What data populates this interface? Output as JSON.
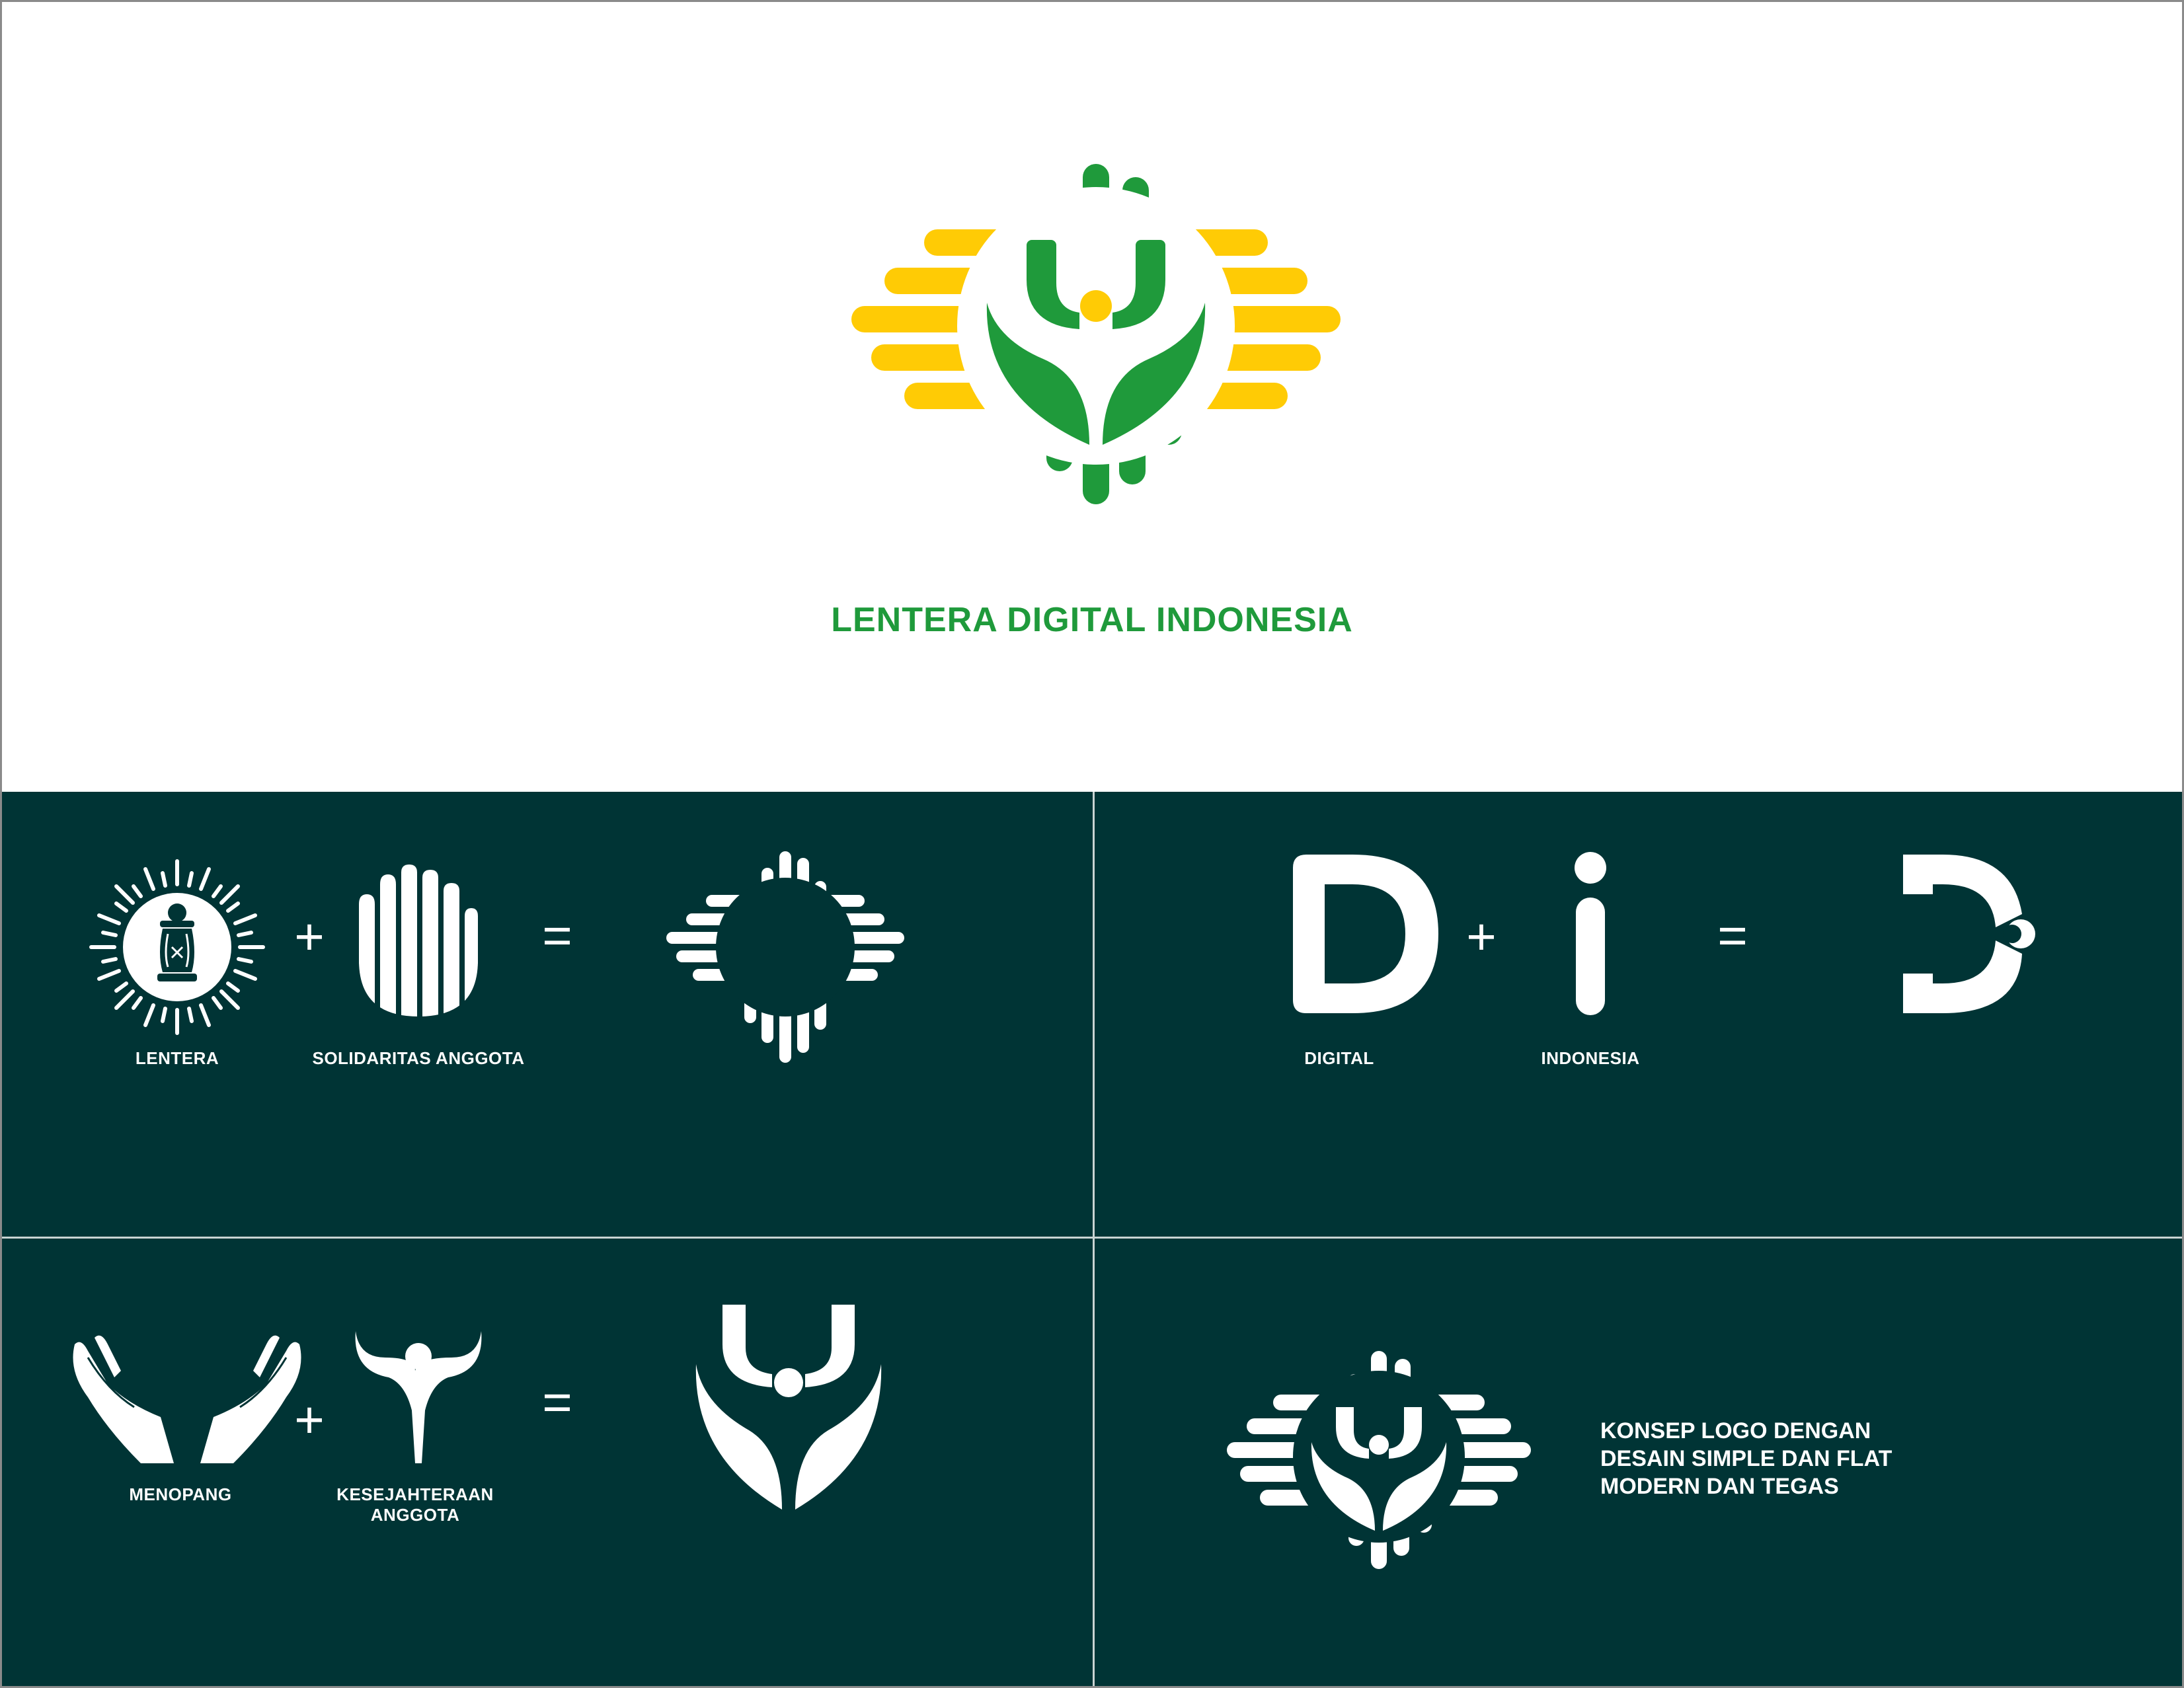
{
  "brand": {
    "name": "LENTERA DIGITAL INDONESIA",
    "colors": {
      "green": "#1f9a3b",
      "yellow": "#ffcb05",
      "panel": "#003435",
      "white": "#ffffff"
    }
  },
  "panel1": {
    "label_left": "LENTERA",
    "label_right": "SOLIDARITAS ANGGOTA",
    "plus": "+",
    "equals": "="
  },
  "panel2": {
    "big_letter": "D",
    "small_letter": "i",
    "label_left": "DIGITAL",
    "label_right": "INDONESIA",
    "plus": "+",
    "equals": "="
  },
  "panel3": {
    "label_left": "MENOPANG",
    "label_right_1": "KESEJAHTERAAN",
    "label_right_2": "ANGGOTA",
    "plus": "+",
    "equals": "="
  },
  "panel4": {
    "concept_lines": [
      "KONSEP LOGO DENGAN",
      "DESAIN SIMPLE DAN FLAT",
      "MODERN DAN TEGAS"
    ]
  },
  "icons": [
    "main-logo-icon",
    "lantern-icon",
    "hand-icon",
    "frame-icon",
    "d-letter-icon",
    "di-mark-icon",
    "open-hands-icon",
    "person-icon",
    "person-leaf-icon",
    "full-logo-icon"
  ]
}
